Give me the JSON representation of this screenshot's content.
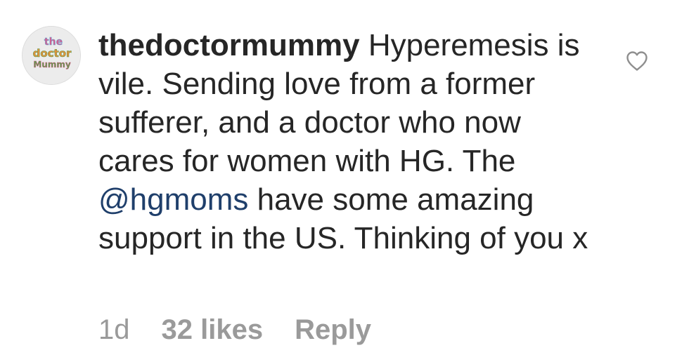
{
  "comment": {
    "avatar_icon": "profile-logo-icon",
    "avatar_lines": [
      "the",
      "doctor",
      "Mummy"
    ],
    "username": "thedoctormummy",
    "text_before_mention": " Hyperemesis is vile. Sending love from a former sufferer, and a doctor who now cares for women with HG. The ",
    "mention": "@hgmoms",
    "text_after_mention": " have some amazing support in the US. Thinking of you x",
    "like_icon": "heart-outline-icon",
    "time": "1d",
    "likes": "32 likes",
    "reply": "Reply"
  },
  "colors": {
    "text": "#262626",
    "mention": "#1f3f6b",
    "meta": "#9a9a9a"
  }
}
